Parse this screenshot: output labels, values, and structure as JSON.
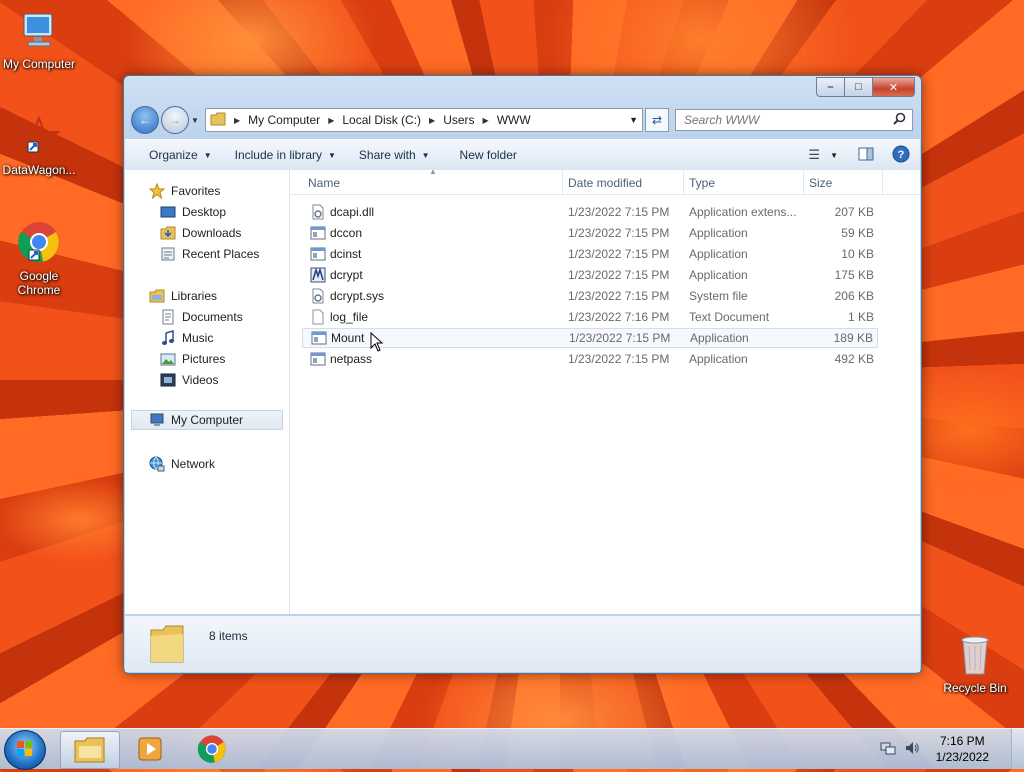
{
  "desktop": {
    "icons": [
      {
        "label": "My Computer"
      },
      {
        "label": "DataWagon..."
      },
      {
        "label": "Google Chrome"
      },
      {
        "label": "Recycle Bin"
      }
    ]
  },
  "window": {
    "address": [
      "My Computer",
      "Local Disk (C:)",
      "Users",
      "WWW"
    ],
    "search_placeholder": "Search WWW",
    "toolbar": {
      "organize": "Organize",
      "include": "Include in library",
      "share": "Share with",
      "new_folder": "New folder"
    },
    "nav": {
      "favorites": "Favorites",
      "desktop": "Desktop",
      "downloads": "Downloads",
      "recent": "Recent Places",
      "libraries": "Libraries",
      "documents": "Documents",
      "music": "Music",
      "pictures": "Pictures",
      "videos": "Videos",
      "computer": "My Computer",
      "network": "Network"
    },
    "columns": {
      "name": "Name",
      "date": "Date modified",
      "type": "Type",
      "size": "Size"
    },
    "files": [
      {
        "name": "dcapi.dll",
        "date": "1/23/2022 7:15 PM",
        "type": "Application extens...",
        "size": "207 KB"
      },
      {
        "name": "dccon",
        "date": "1/23/2022 7:15 PM",
        "type": "Application",
        "size": "59 KB"
      },
      {
        "name": "dcinst",
        "date": "1/23/2022 7:15 PM",
        "type": "Application",
        "size": "10 KB"
      },
      {
        "name": "dcrypt",
        "date": "1/23/2022 7:15 PM",
        "type": "Application",
        "size": "175 KB"
      },
      {
        "name": "dcrypt.sys",
        "date": "1/23/2022 7:15 PM",
        "type": "System file",
        "size": "206 KB"
      },
      {
        "name": "log_file",
        "date": "1/23/2022 7:16 PM",
        "type": "Text Document",
        "size": "1 KB"
      },
      {
        "name": "Mount",
        "date": "1/23/2022 7:15 PM",
        "type": "Application",
        "size": "189 KB"
      },
      {
        "name": "netpass",
        "date": "1/23/2022 7:15 PM",
        "type": "Application",
        "size": "492 KB"
      }
    ],
    "status": "8 items"
  },
  "taskbar": {
    "time": "7:16 PM",
    "date": "1/23/2022"
  }
}
